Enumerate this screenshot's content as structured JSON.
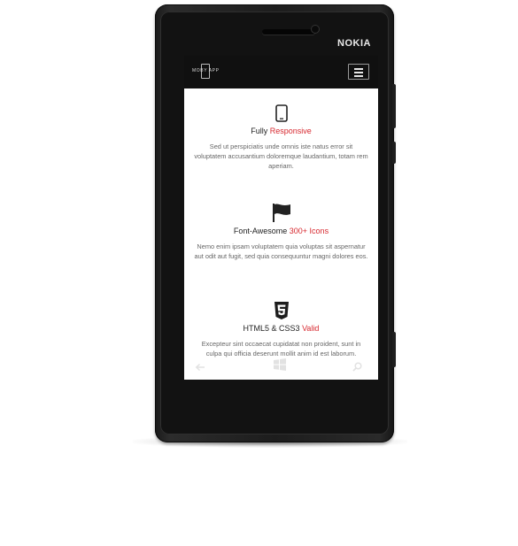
{
  "device": {
    "brand": "NOKIA"
  },
  "app": {
    "logo_text": "MOBY APP",
    "menu_icon": "hamburger-menu-icon"
  },
  "features": [
    {
      "icon": "mobile-phone-icon",
      "title_plain": "Fully ",
      "title_highlight": "Responsive",
      "text": "Sed ut perspiciatis unde omnis iste natus error sit voluptatem accusantium doloremque laudantium, totam rem aperiam."
    },
    {
      "icon": "flag-icon",
      "title_plain": "Font-Awesome ",
      "title_highlight": "300+ Icons",
      "text": "Nemo enim ipsam voluptatem quia voluptas sit aspernatur aut odit aut fugit, sed quia consequuntur magni dolores eos."
    },
    {
      "icon": "html5-icon",
      "title_plain": "HTML5 & CSS3 ",
      "title_highlight": "Valid",
      "text": "Excepteur sint occaecat cupidatat non proident, sunt in culpa qui officia deserunt mollit anim id est laborum."
    }
  ],
  "hardware_keys": {
    "back": "back-arrow-icon",
    "start": "windows-start-icon",
    "search": "search-icon"
  },
  "colors": {
    "accent": "#d7282f",
    "navbar": "#101010",
    "phone_body": "#1d1d1d"
  }
}
